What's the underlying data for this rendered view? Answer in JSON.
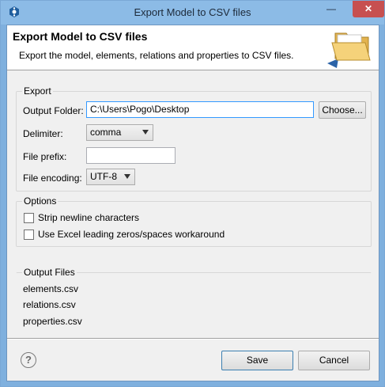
{
  "window": {
    "title": "Export Model to CSV files"
  },
  "banner": {
    "title": "Export Model to CSV files",
    "description": "Export the model, elements, relations and properties to CSV files."
  },
  "export_group": {
    "label": "Export",
    "output_folder_label": "Output Folder:",
    "output_folder_value": "C:\\Users\\Pogo\\Desktop",
    "choose_button": "Choose...",
    "delimiter_label": "Delimiter:",
    "delimiter_value": "comma",
    "file_prefix_label": "File prefix:",
    "file_prefix_value": "",
    "file_encoding_label": "File encoding:",
    "file_encoding_value": "UTF-8"
  },
  "options_group": {
    "label": "Options",
    "strip_newline_label": "Strip newline characters",
    "strip_newline_checked": false,
    "excel_workaround_label": "Use Excel leading zeros/spaces workaround",
    "excel_workaround_checked": false
  },
  "output_files": {
    "label": "Output Files",
    "files": [
      "elements.csv",
      "relations.csv",
      "properties.csv"
    ]
  },
  "footer": {
    "help_icon": "?",
    "save_button": "Save",
    "cancel_button": "Cancel"
  },
  "colors": {
    "titlebar": "#8cbbe6",
    "close_button": "#c75050",
    "dialog_background": "#f0f0f0",
    "focus_border": "#3399ff"
  }
}
